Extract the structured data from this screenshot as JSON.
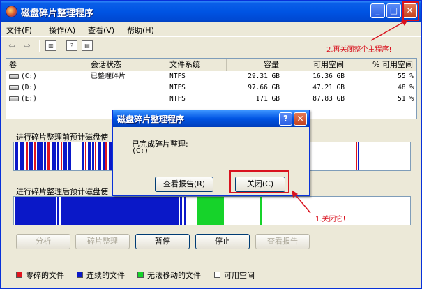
{
  "window": {
    "title": "磁盘碎片整理程序"
  },
  "menu": [
    "文件(F)",
    "操作(A)",
    "查看(V)",
    "帮助(H)"
  ],
  "table": {
    "headers": [
      "卷",
      "会话状态",
      "文件系统",
      "容量",
      "可用空间",
      "% 可用空间"
    ],
    "rows": [
      {
        "volume": "(C:)",
        "status": "已整理碎片",
        "fs": "NTFS",
        "capacity": "29.31 GB",
        "free": "16.36 GB",
        "pct": "55 %"
      },
      {
        "volume": "(D:)",
        "status": "",
        "fs": "NTFS",
        "capacity": "97.66 GB",
        "free": "47.21 GB",
        "pct": "48 %"
      },
      {
        "volume": "(E:)",
        "status": "",
        "fs": "NTFS",
        "capacity": "171 GB",
        "free": "87.83 GB",
        "pct": "51 %"
      }
    ]
  },
  "analysis": {
    "before_label": "进行碎片整理前预计磁盘使",
    "after_label": "进行碎片整理后预计磁盘使"
  },
  "buttons": {
    "analyze": "分析",
    "defrag": "碎片整理",
    "pause": "暂停",
    "stop": "停止",
    "report": "查看报告"
  },
  "legend": {
    "fragmented": "零碎的文件",
    "contiguous": "连续的文件",
    "unmovable": "无法移动的文件",
    "free": "可用空间"
  },
  "colors": {
    "fragmented": "#e0141e",
    "contiguous": "#0a18c8",
    "unmovable": "#16d32a",
    "free": "#ffffff"
  },
  "dialog": {
    "title": "磁盘碎片整理程序",
    "message_line1": "已完成碎片整理:",
    "message_line2": "(C:)",
    "report_button": "查看报告(R)",
    "close_button": "关闭(C)"
  },
  "annotations": {
    "close_dialog": "1.关闭它!",
    "close_program": "2.再关闭整个主程序!"
  }
}
